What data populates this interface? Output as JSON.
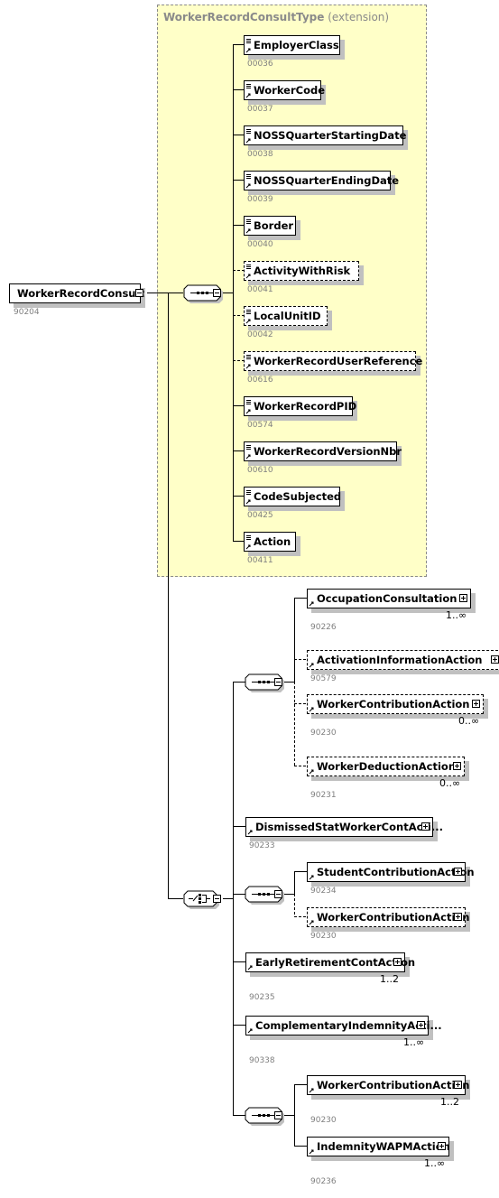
{
  "root": {
    "name": "WorkerRecordConsult",
    "code": "90204"
  },
  "extension": {
    "type_name": "WorkerRecordConsultType",
    "suffix": "(extension)"
  },
  "sequence_elements": [
    {
      "name": "EmployerClass",
      "code": "00036",
      "optional": false
    },
    {
      "name": "WorkerCode",
      "code": "00037",
      "optional": false
    },
    {
      "name": "NOSSQuarterStartingDate",
      "code": "00038",
      "optional": false
    },
    {
      "name": "NOSSQuarterEndingDate",
      "code": "00039",
      "optional": false
    },
    {
      "name": "Border",
      "code": "00040",
      "optional": false
    },
    {
      "name": "ActivityWithRisk",
      "code": "00041",
      "optional": true
    },
    {
      "name": "LocalUnitID",
      "code": "00042",
      "optional": true
    },
    {
      "name": "WorkerRecordUserReference",
      "code": "00616",
      "optional": true
    },
    {
      "name": "WorkerRecordPID",
      "code": "00574",
      "optional": false
    },
    {
      "name": "WorkerRecordVersionNbr",
      "code": "00610",
      "optional": false
    },
    {
      "name": "CodeSubjected",
      "code": "00425",
      "optional": false
    },
    {
      "name": "Action",
      "code": "00411",
      "optional": false
    }
  ],
  "choice_group1": [
    {
      "name": "OccupationConsultation",
      "code": "90226",
      "optional": false,
      "cardinality": "1..∞"
    },
    {
      "name": "ActivationInformationAction",
      "code": "90579",
      "optional": true,
      "cardinality": ""
    },
    {
      "name": "WorkerContributionAction",
      "code": "90230",
      "optional": true,
      "cardinality": "0..∞"
    },
    {
      "name": "WorkerDeductionAction",
      "code": "90231",
      "optional": true,
      "cardinality": "0..∞"
    }
  ],
  "choice_single1": {
    "name": "DismissedStatWorkerContActi...",
    "code": "90233"
  },
  "choice_group2": [
    {
      "name": "StudentContributionAction",
      "code": "90234",
      "optional": false,
      "cardinality": ""
    },
    {
      "name": "WorkerContributionAction",
      "code": "90230",
      "optional": true,
      "cardinality": ""
    }
  ],
  "choice_single2": {
    "name": "EarlyRetirementContAction",
    "code": "90235",
    "cardinality": "1..2"
  },
  "choice_single3": {
    "name": "ComplementaryIndemnityActi...",
    "code": "90338",
    "cardinality": "1..∞"
  },
  "choice_group3": [
    {
      "name": "WorkerContributionAction",
      "code": "90230",
      "cardinality": "1..2"
    },
    {
      "name": "IndemnityWAPMAction",
      "code": "90236",
      "cardinality": "1..∞"
    }
  ]
}
